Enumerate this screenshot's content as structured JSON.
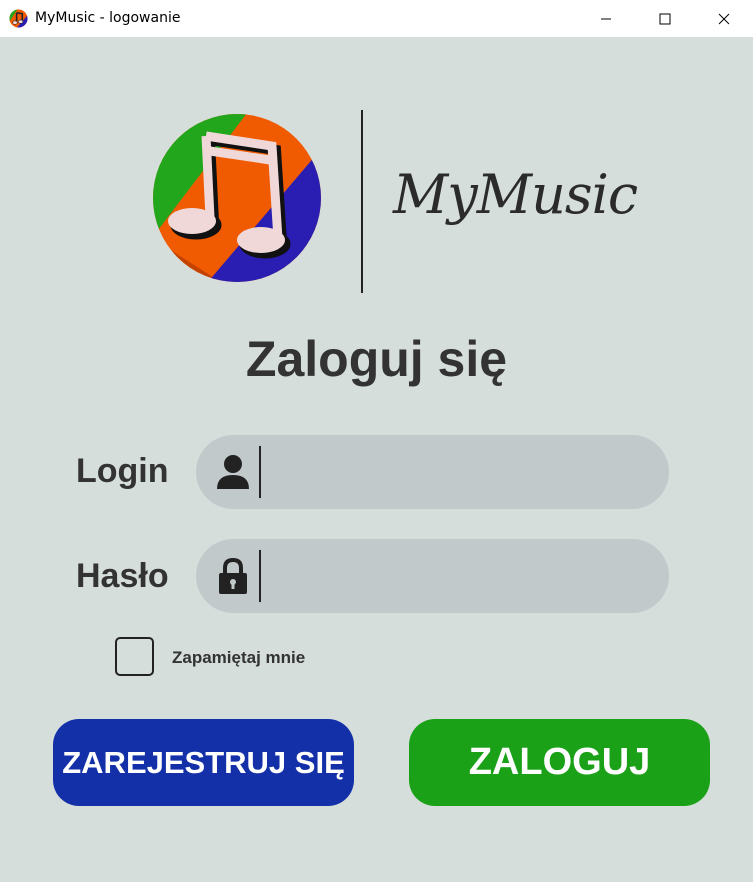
{
  "window": {
    "title": "MyMusic - logowanie",
    "controls": {
      "minimize": "minimize-icon",
      "maximize": "maximize-icon",
      "close": "close-icon"
    }
  },
  "logo": {
    "icon": "music-note-icon",
    "brand_name": "MyMusic",
    "colors": [
      "#22a61c",
      "#f05a00",
      "#2a1db2"
    ]
  },
  "heading": "Zaloguj się",
  "form": {
    "login": {
      "label": "Login",
      "icon": "user-icon",
      "value": "",
      "placeholder": ""
    },
    "password": {
      "label": "Hasło",
      "icon": "lock-icon",
      "value": "",
      "placeholder": ""
    },
    "remember": {
      "label": "Zapamiętaj mnie",
      "checked": false
    }
  },
  "buttons": {
    "register": "ZAREJESTRUJ SIĘ",
    "login": "ZALOGUJ"
  },
  "colors": {
    "background": "#d6dedb",
    "field_bg": "#c1c9ca",
    "register_bg": "#1330a8",
    "login_bg": "#1aa118"
  }
}
